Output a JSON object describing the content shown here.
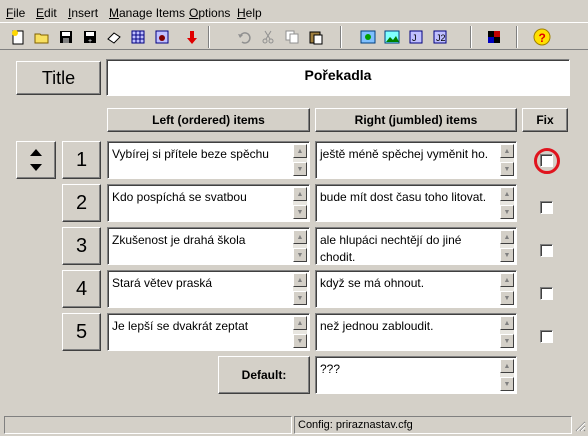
{
  "menu": [
    {
      "label": "File"
    },
    {
      "label": "Edit"
    },
    {
      "label": "Insert"
    },
    {
      "label": "Manage Items"
    },
    {
      "label": "Options"
    },
    {
      "label": "Help"
    }
  ],
  "toolbar": {
    "icons": [
      "new-file-icon",
      "open-folder-icon",
      "save-icon",
      "save-as-icon",
      "eraser-icon",
      "grid-icon",
      "grid-bug-icon",
      "down-arrow-icon",
      "undo-icon",
      "cut-icon",
      "copy-icon",
      "paste-icon",
      "export-web-icon",
      "export-image-icon",
      "export-java-icon",
      "export-java-2-icon",
      "checkerboard-icon",
      "help-icon"
    ],
    "help_symbol": "?"
  },
  "title_label": "Title",
  "title_value": "Pořekadla",
  "headers": {
    "left": "Left (ordered) items",
    "right": "Right (jumbled) items",
    "fix": "Fix"
  },
  "rows": [
    {
      "num": "1",
      "left": "Vybírej si přítele beze spěchu",
      "right": "ještě méně spěchej vyměnit ho.",
      "fix": false,
      "highlighted": true
    },
    {
      "num": "2",
      "left": "Kdo pospíchá se svatbou",
      "right": "bude mít dost času toho litovat.",
      "fix": false,
      "highlighted": false
    },
    {
      "num": "3",
      "left": "Zkušenost je drahá škola",
      "right": "ale hlupáci nechtějí do jiné chodit.",
      "fix": false,
      "highlighted": false
    },
    {
      "num": "4",
      "left": "Stará větev praská",
      "right": "když se má ohnout.",
      "fix": false,
      "highlighted": false
    },
    {
      "num": "5",
      "left": "Je lepší se dvakrát zeptat",
      "right": "než jednou zabloudit.",
      "fix": false,
      "highlighted": false
    }
  ],
  "default": {
    "label": "Default:",
    "value": "???"
  },
  "status": {
    "config": "Config: priraznastav.cfg"
  },
  "colors": {
    "highlight_ring": "#e0141e",
    "background": "#d4d0c8"
  }
}
